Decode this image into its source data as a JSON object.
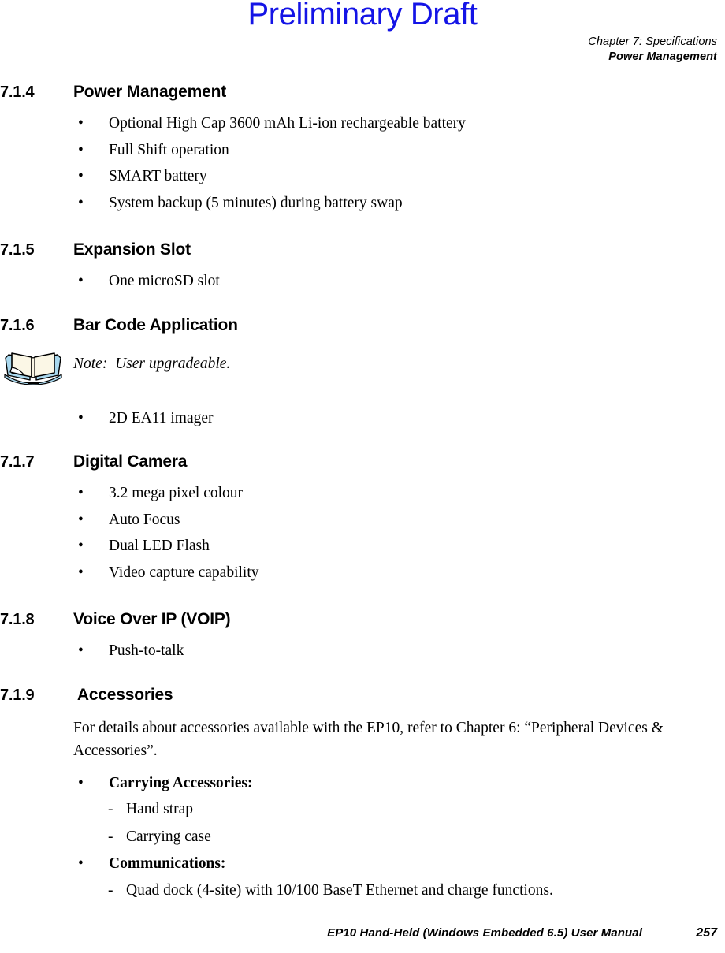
{
  "watermark": {
    "text": "Preliminary Draft",
    "color": "#1414e6"
  },
  "running_head": {
    "chapter": "Chapter 7:  Specifications",
    "topic": "Power Management"
  },
  "sections": [
    {
      "number": "7.1.4",
      "title": "Power Management",
      "bullets": [
        "Optional High Cap 3600 mAh Li-ion rechargeable battery",
        "Full Shift operation",
        "SMART battery",
        "System backup (5 minutes) during battery swap"
      ]
    },
    {
      "number": "7.1.5",
      "title": "Expansion Slot",
      "bullets": [
        "One microSD slot"
      ]
    },
    {
      "number": "7.1.6",
      "title": "Bar Code Application",
      "note": "Note:  User upgradeable.",
      "bullets": [
        "2D EA11 imager"
      ]
    },
    {
      "number": "7.1.7",
      "title": "Digital Camera",
      "bullets": [
        "3.2 mega pixel colour",
        "Auto Focus",
        "Dual LED Flash",
        "Video capture capability"
      ]
    },
    {
      "number": "7.1.8",
      "title": "Voice Over IP (VOIP)",
      "bullets": [
        "Push-to-talk"
      ]
    },
    {
      "number": "7.1.9",
      "title": " Accessories",
      "paragraph": "For details about accessories available with the EP10, refer to Chapter 6: “Peripheral Devices & Accessories”.",
      "groups": [
        {
          "label": "Carrying Accessories:",
          "items": [
            "Hand strap",
            "Carrying case"
          ]
        },
        {
          "label": "Communications:",
          "items": [
            "Quad dock (4-site) with 10/100 BaseT Ethernet and charge functions."
          ]
        }
      ]
    }
  ],
  "markers": {
    "bullet": "•",
    "dash": "-"
  },
  "footer": {
    "title": "EP10 Hand-Held (Windows Embedded 6.5) User Manual",
    "page": "257"
  },
  "note_icon": {
    "name": "open-book-icon",
    "page_color": "#fbf7e6",
    "cover_color": "#a9d8ee",
    "outline_color": "#000000"
  }
}
